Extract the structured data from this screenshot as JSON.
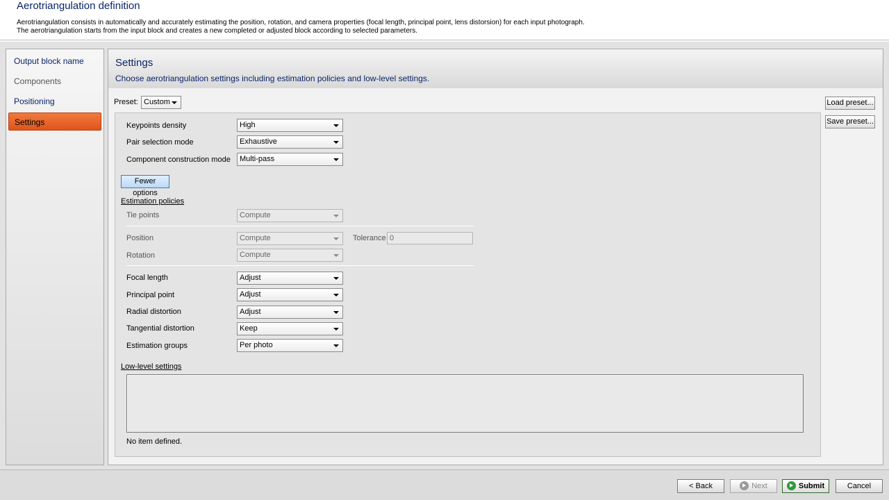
{
  "header": {
    "title": "Aerotriangulation definition",
    "desc_line1": "Aerotriangulation consists in automatically and accurately estimating the position, rotation, and camera properties (focal length, principal point, lens distorsion) for each input photograph.",
    "desc_line2": "The aerotriangulation starts from the input block and creates a new completed or adjusted block according to selected parameters."
  },
  "sidebar": {
    "items": [
      {
        "label": "Output block name"
      },
      {
        "label": "Components"
      },
      {
        "label": "Positioning"
      },
      {
        "label": "Settings"
      }
    ]
  },
  "main": {
    "title": "Settings",
    "subtitle": "Choose aerotriangulation settings including estimation policies and low-level settings."
  },
  "preset": {
    "label": "Preset:",
    "value": "Custom",
    "load_label": "Load preset...",
    "save_label": "Save preset..."
  },
  "settings": {
    "keypoints_density": {
      "label": "Keypoints density",
      "value": "High"
    },
    "pair_selection": {
      "label": "Pair selection mode",
      "value": "Exhaustive"
    },
    "component_construction": {
      "label": "Component construction mode",
      "value": "Multi-pass"
    },
    "fewer_options": "Fewer options"
  },
  "estimation": {
    "heading": "Estimation policies",
    "tie_points": {
      "label": "Tie points",
      "value": "Compute"
    },
    "position": {
      "label": "Position",
      "value": "Compute"
    },
    "tolerance": {
      "label": "Tolerance",
      "value": "0"
    },
    "rotation": {
      "label": "Rotation",
      "value": "Compute"
    },
    "focal_length": {
      "label": "Focal length",
      "value": "Adjust"
    },
    "principal_point": {
      "label": "Principal point",
      "value": "Adjust"
    },
    "radial_distortion": {
      "label": "Radial distortion",
      "value": "Adjust"
    },
    "tangential_distortion": {
      "label": "Tangential distortion",
      "value": "Keep"
    },
    "estimation_groups": {
      "label": "Estimation groups",
      "value": "Per photo"
    }
  },
  "low_level": {
    "heading": "Low-level settings",
    "empty_text": "No item defined."
  },
  "footer": {
    "back": "< Back",
    "next": "Next",
    "submit": "Submit",
    "cancel": "Cancel"
  }
}
